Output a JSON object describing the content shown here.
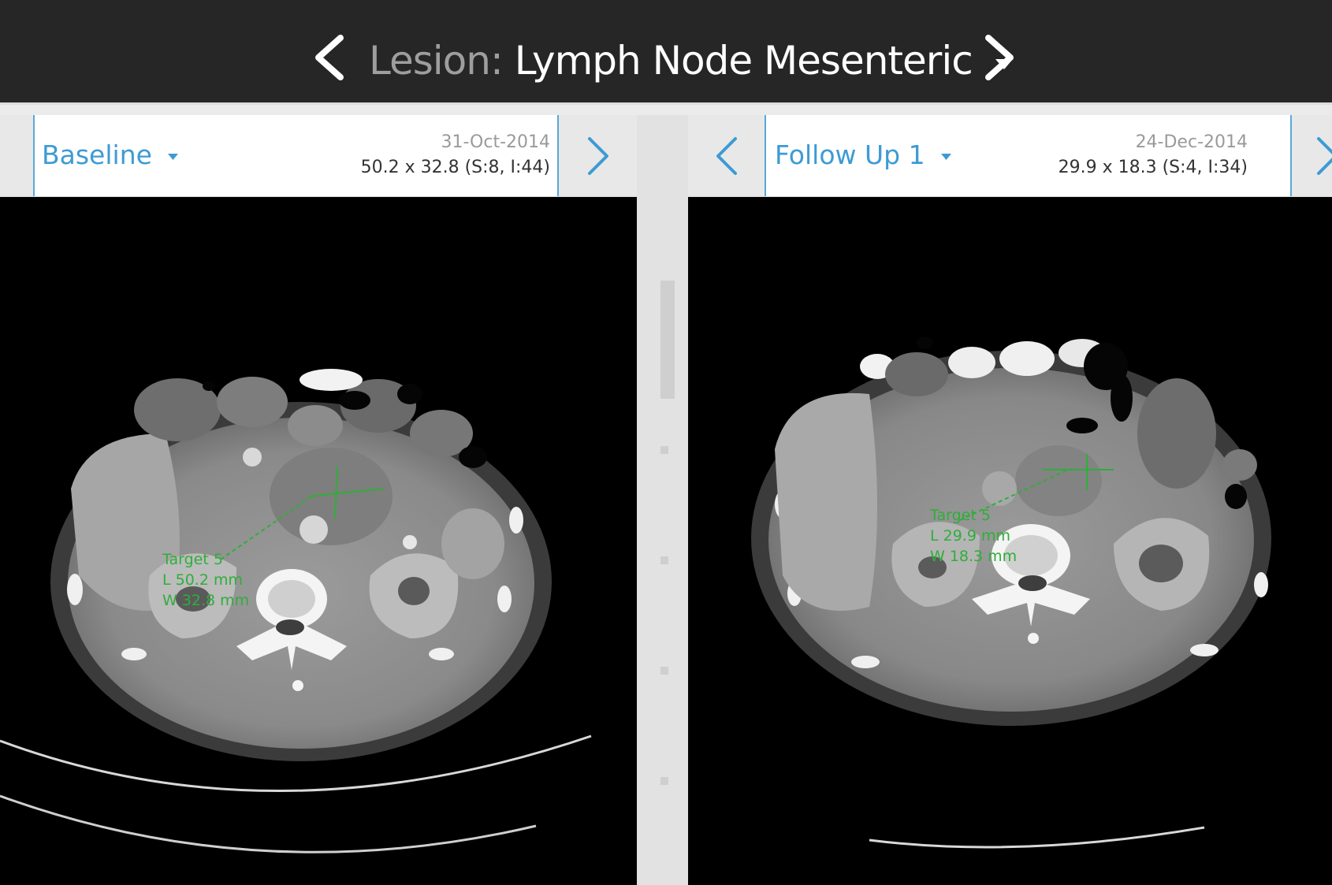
{
  "header": {
    "lesion_prefix": "Lesion:",
    "lesion_name": "Lymph Node Mesenteric",
    "icons": {
      "prev": "chevron-left-icon",
      "next": "chevron-right-icon",
      "dropdown": "caret-down-icon"
    }
  },
  "panels": [
    {
      "timepoint_label": "Baseline",
      "date": "31-Oct-2014",
      "measurement": "50.2 x 32.8 (S:8, I:44)",
      "annotation": [
        "Target 5",
        "L 50.2 mm",
        "W 32.8 mm"
      ]
    },
    {
      "timepoint_label": "Follow Up 1",
      "date": "24-Dec-2014",
      "measurement": "29.9 x 18.3 (S:4, I:34)",
      "annotation": [
        "Target 5",
        "L 29.9 mm",
        "W 18.3 mm"
      ]
    }
  ],
  "colors": {
    "topbar": "#262626",
    "accent": "#3d9bd4",
    "annotation": "#2fae3a",
    "lesion_prefix": "#9e9e9e"
  }
}
